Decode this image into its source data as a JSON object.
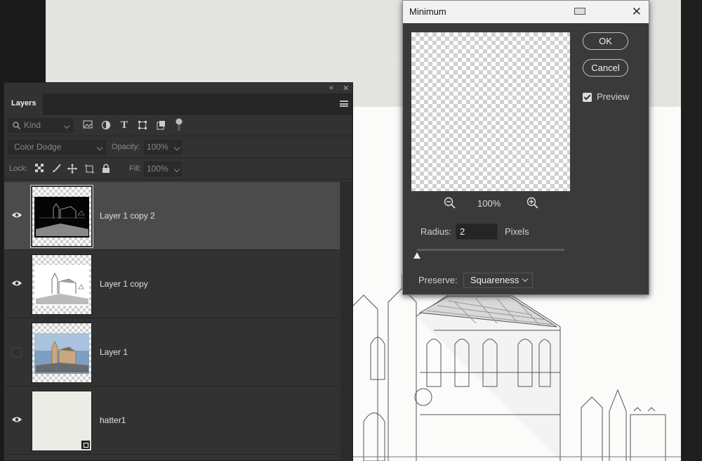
{
  "layers_panel": {
    "tab_label": "Layers",
    "filter": {
      "placeholder": "Kind"
    },
    "blend_mode": "Color Dodge",
    "opacity_label": "Opacity:",
    "opacity_value": "100%",
    "lock_label": "Lock:",
    "fill_label": "Fill:",
    "fill_value": "100%",
    "layers": [
      {
        "name": "Layer 1 copy 2",
        "visible": true,
        "selected": true
      },
      {
        "name": "Layer 1 copy",
        "visible": true,
        "selected": false
      },
      {
        "name": "Layer 1",
        "visible": false,
        "selected": false
      },
      {
        "name": "hatter1",
        "visible": true,
        "selected": false,
        "smart_object": true
      }
    ],
    "filter_icons": [
      "image-filter-icon",
      "adjustment-filter-icon",
      "type-filter-icon",
      "shape-filter-icon",
      "smart-object-filter-icon",
      "filter-toggle-icon"
    ],
    "lock_icons": [
      "lock-pixels-icon",
      "lock-brush-icon",
      "lock-position-icon",
      "lock-artboard-icon",
      "lock-all-icon"
    ]
  },
  "dialog": {
    "title": "Minimum",
    "ok_label": "OK",
    "cancel_label": "Cancel",
    "preview_label": "Preview",
    "preview_checked": true,
    "zoom_value": "100%",
    "radius_label": "Radius:",
    "radius_value": "2",
    "radius_unit": "Pixels",
    "preserve_label": "Preserve:",
    "preserve_value": "Squareness"
  },
  "colors": {
    "panel_bg": "#323232",
    "selected_layer_bg": "#4b4b4b",
    "dialog_bg": "#3a3a3a",
    "canvas_bg": "#e6e6e2"
  }
}
